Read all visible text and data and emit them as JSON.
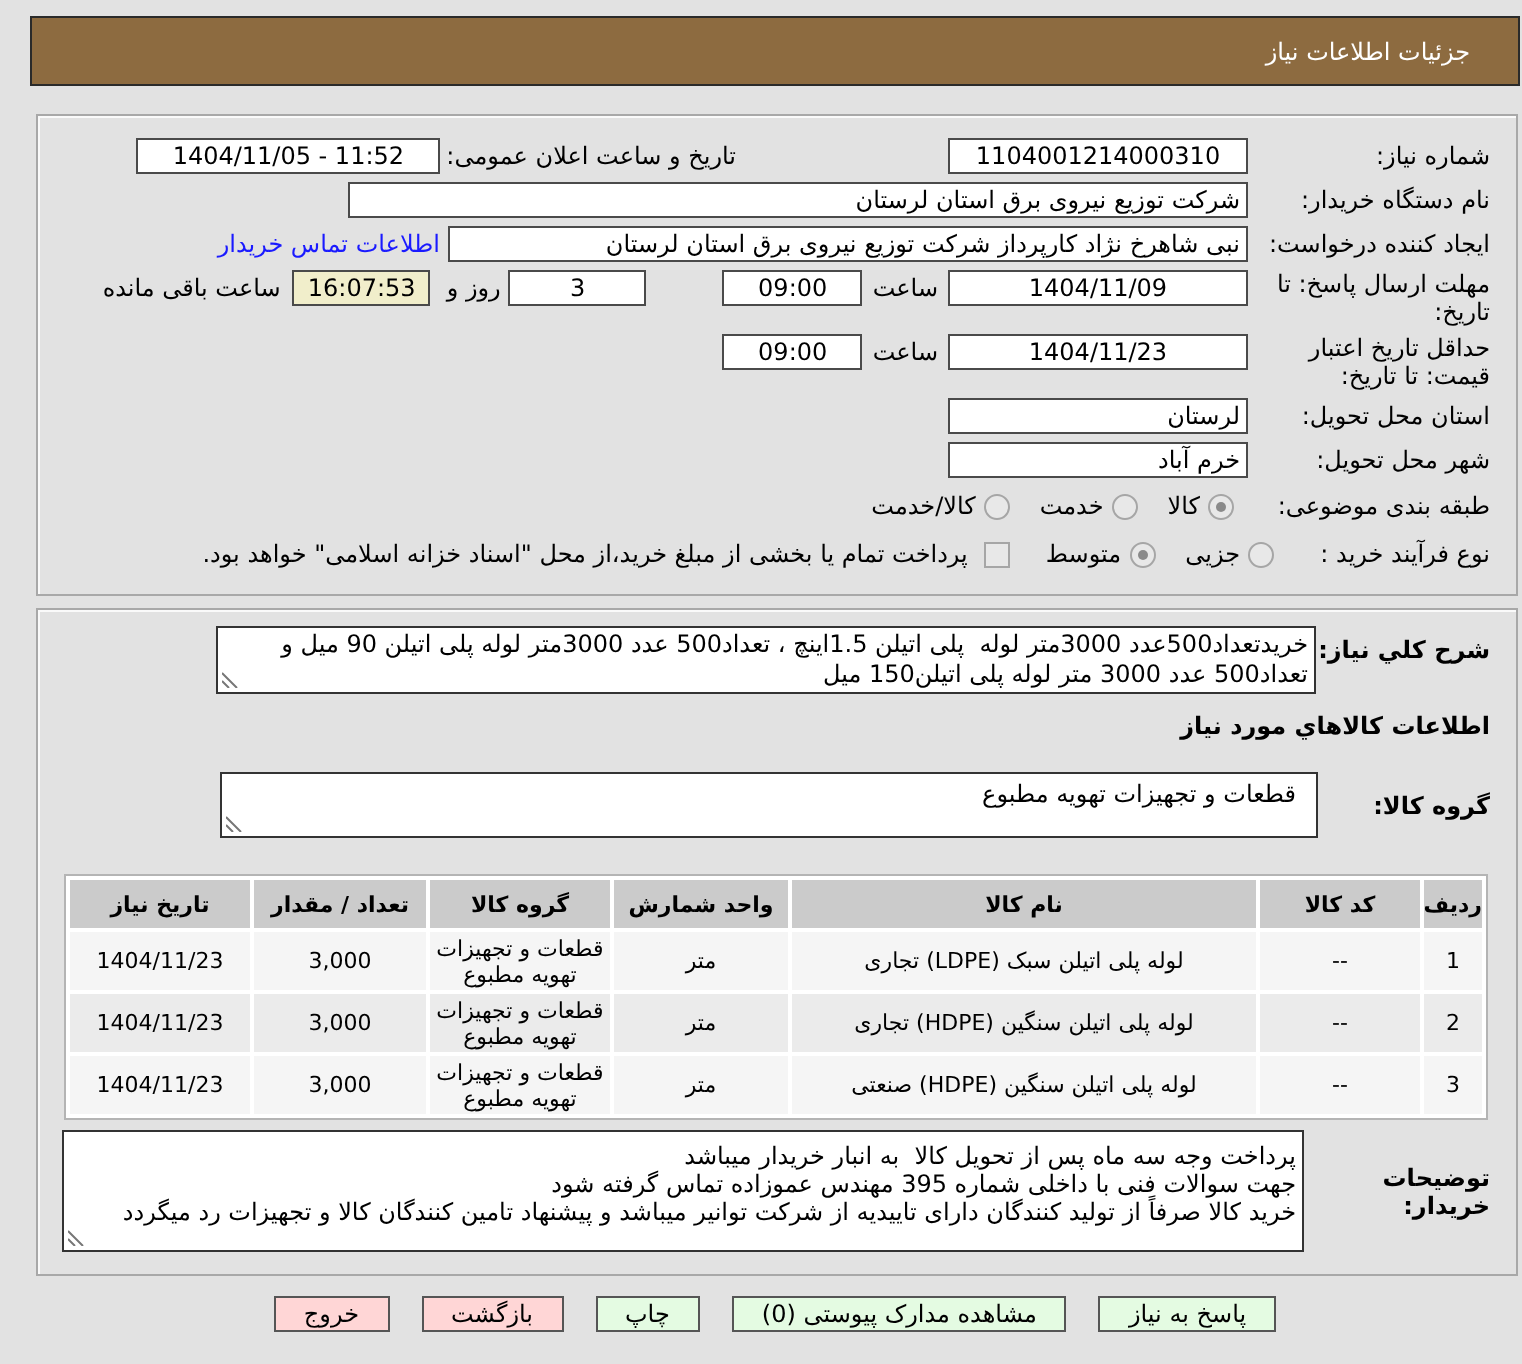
{
  "header": {
    "title": "جزئیات اطلاعات نیاز"
  },
  "details": {
    "need_number": {
      "label": "شماره نیاز:",
      "value": "1104001214000310"
    },
    "announcement": {
      "label": "تاریخ و ساعت اعلان عمومی:",
      "value": "1404/11/05 - 11:52"
    },
    "buyer": {
      "label": "نام دستگاه خریدار:",
      "value": "شرکت توزیع نیروی برق استان لرستان"
    },
    "requester": {
      "label": "ایجاد کننده درخواست:",
      "value": "نبی شاهرخ نژاد کارپرداز شرکت توزیع نیروی برق استان لرستان",
      "contact_link": "اطلاعات تماس خریدار"
    },
    "response_deadline": {
      "label": "مهلت ارسال پاسخ: تا تاریخ:",
      "date": "1404/11/09",
      "time_label": "ساعت",
      "time": "09:00",
      "days": "3",
      "days_label": "روز و",
      "remaining": "16:07:53",
      "remaining_label": "ساعت باقی مانده"
    },
    "price_validity": {
      "label": "حداقل تاریخ اعتبار قیمت: تا تاریخ:",
      "date": "1404/11/23",
      "time_label": "ساعت",
      "time": "09:00"
    },
    "delivery_province": {
      "label": "استان محل تحویل:",
      "value": "لرستان"
    },
    "delivery_city": {
      "label": "شهر محل تحویل:",
      "value": "خرم آباد"
    },
    "category": {
      "label": "طبقه بندی موضوعی:",
      "options": [
        {
          "label": "کالا",
          "selected": true,
          "disabled": true
        },
        {
          "label": "خدمت",
          "selected": false,
          "disabled": true
        },
        {
          "label": "کالا/خدمت",
          "selected": false,
          "disabled": true
        }
      ]
    },
    "purchase_type": {
      "label": "نوع فرآیند خرید :",
      "options": [
        {
          "label": "جزیی",
          "selected": false,
          "disabled": true
        },
        {
          "label": "متوسط",
          "selected": true,
          "disabled": true
        }
      ],
      "treasury_payment": {
        "label": "پرداخت تمام یا بخشی از مبلغ خرید،از محل \"اسناد خزانه اسلامی\" خواهد بود.",
        "checked": false,
        "disabled": true
      }
    }
  },
  "goods": {
    "description": {
      "label": "شرح کلي نياز:",
      "value": "خریدتعداد500عدد 3000متر لوله  پلی اتیلن 1.5اینچ ، تعداد500 عدد 3000متر لوله پلی اتیلن 90 میل و\nتعداد500 عدد 3000 متر لوله پلی اتیلن150 میل"
    },
    "heading": "اطلاعات کالاهاي مورد نياز",
    "group": {
      "label": "گروه کالا:",
      "value": "قطعات و تجهیزات تهویه مطبوع"
    },
    "table": {
      "columns": [
        "ردیف",
        "کد کالا",
        "نام کالا",
        "واحد شمارش",
        "گروه کالا",
        "تعداد / مقدار",
        "تاریخ نیاز"
      ],
      "rows": [
        {
          "cells": [
            "1",
            "--",
            "لوله پلی اتیلن سبک (LDPE) تجاری",
            "متر",
            "قطعات و تجهیزات تهویه مطبوع",
            "3,000",
            "1404/11/23"
          ]
        },
        {
          "cells": [
            "2",
            "--",
            "لوله پلی اتیلن سنگین (HDPE) تجاری",
            "متر",
            "قطعات و تجهیزات تهویه مطبوع",
            "3,000",
            "1404/11/23"
          ]
        },
        {
          "cells": [
            "3",
            "--",
            "لوله پلی اتیلن سنگین (HDPE) صنعتی",
            "متر",
            "قطعات و تجهیزات تهویه مطبوع",
            "3,000",
            "1404/11/23"
          ]
        }
      ]
    },
    "buyer_notes": {
      "label": "توضیحات خریدار:",
      "value": "پرداخت وجه سه ماه پس از تحویل کالا  به انبار خریدار میباشد\nجهت سوالات فنی با داخلی شماره 395 مهندس عموزاده تماس گرفته شود\nخرید کالا صرفاً از تولید کنندگان دارای تاییدیه از شرکت توانیر میباشد و پیشنهاد تامین کنندگان کالا و تجهیزات رد میگردد"
    }
  },
  "buttons": [
    {
      "label": "پاسخ به نیاز",
      "kind": "action"
    },
    {
      "label": "مشاهده مدارک پیوستی (0)",
      "kind": "action"
    },
    {
      "label": "چاپ",
      "kind": "action"
    },
    {
      "label": "بازگشت",
      "kind": "leave"
    },
    {
      "label": "خروج",
      "kind": "leave"
    }
  ]
}
